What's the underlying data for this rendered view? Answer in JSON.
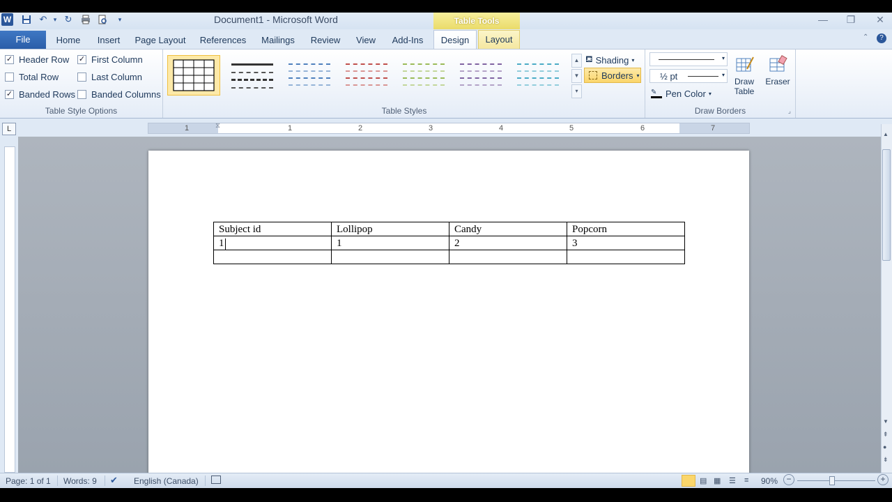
{
  "title_bar": {
    "document_title": "Document1 - Microsoft Word",
    "contextual_label": "Table Tools",
    "qat_icons": [
      "word-logo-icon",
      "save-icon",
      "undo-icon",
      "redo-icon",
      "print-icon",
      "print-preview-icon",
      "customize-qat-icon"
    ],
    "word_logo_text": "W"
  },
  "tabs": [
    {
      "label": "File"
    },
    {
      "label": "Home"
    },
    {
      "label": "Insert"
    },
    {
      "label": "Page Layout"
    },
    {
      "label": "References"
    },
    {
      "label": "Mailings"
    },
    {
      "label": "Review"
    },
    {
      "label": "View"
    },
    {
      "label": "Add-Ins"
    },
    {
      "label": "Design"
    },
    {
      "label": "Layout"
    }
  ],
  "ribbon": {
    "table_style_options": {
      "label": "Table Style Options",
      "options": [
        {
          "label": "Header Row",
          "checked": true
        },
        {
          "label": "First Column",
          "checked": true
        },
        {
          "label": "Total Row",
          "checked": false
        },
        {
          "label": "Last Column",
          "checked": false
        },
        {
          "label": "Banded Rows",
          "checked": true
        },
        {
          "label": "Banded Columns",
          "checked": false
        }
      ]
    },
    "table_styles": {
      "label": "Table Styles",
      "thumbnail_colors": [
        "#000000",
        "#333333",
        "#4f81bd",
        "#c0504d",
        "#9bbb59",
        "#8064a2",
        "#4bacc6"
      ]
    },
    "shading_label": "Shading",
    "borders_label": "Borders",
    "draw_borders": {
      "label": "Draw Borders",
      "pen_weight": "½ pt",
      "pen_color_label": "Pen Color",
      "draw_table_label_1": "Draw",
      "draw_table_label_2": "Table",
      "eraser_label": "Eraser"
    }
  },
  "ruler": {
    "corner_glyph": "L",
    "numbers": [
      "1",
      "1",
      "2",
      "3",
      "4",
      "5",
      "6",
      "7"
    ]
  },
  "document": {
    "table": {
      "rows": [
        [
          "Subject id",
          "Lollipop",
          "Candy",
          "Popcorn"
        ],
        [
          "1",
          "1",
          "2",
          "3"
        ],
        [
          "",
          "",
          "",
          ""
        ]
      ]
    }
  },
  "status_bar": {
    "page": "Page: 1 of 1",
    "words": "Words: 9",
    "language": "English (Canada)",
    "zoom": "90%"
  }
}
